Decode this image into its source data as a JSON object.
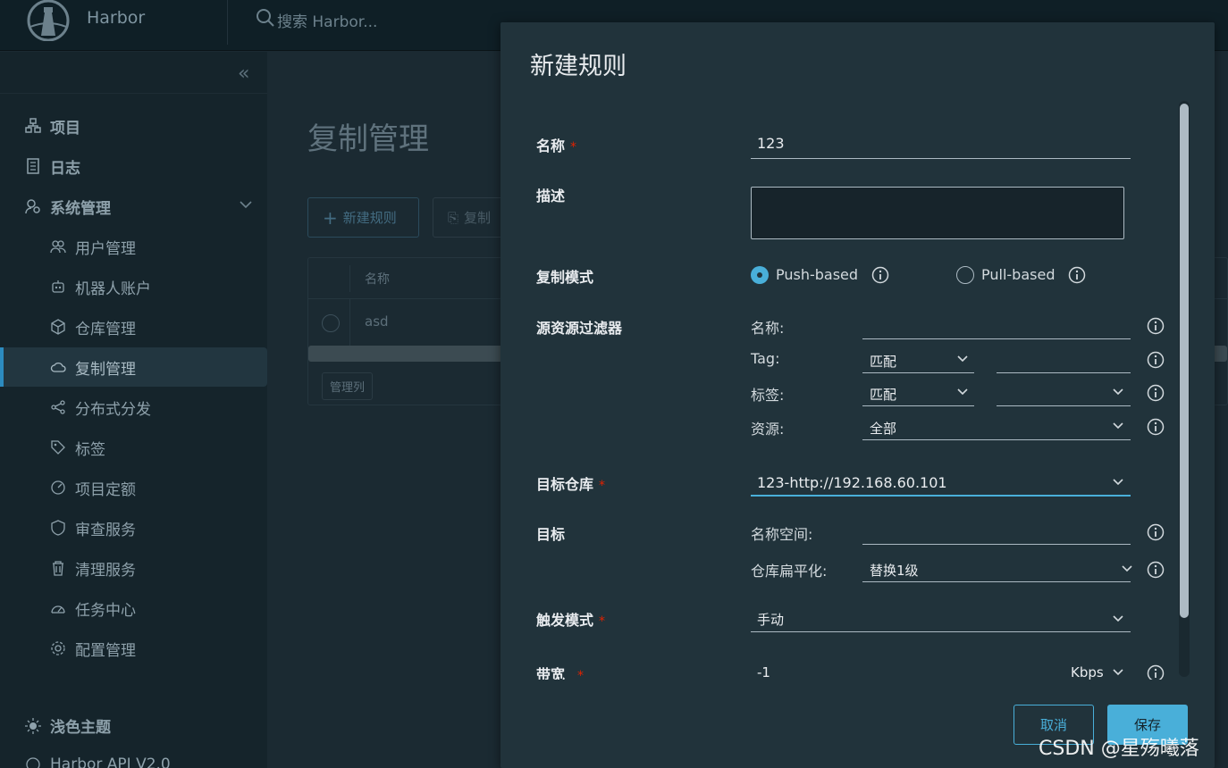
{
  "header": {
    "brand": "Harbor",
    "search_placeholder": "搜索 Harbor..."
  },
  "sidebar": {
    "top_items": [
      {
        "label": "项目",
        "icon": "projects-icon"
      },
      {
        "label": "日志",
        "icon": "logs-icon"
      },
      {
        "label": "系统管理",
        "icon": "admin-icon"
      }
    ],
    "sub_items": [
      {
        "label": "用户管理",
        "icon": "users-icon"
      },
      {
        "label": "机器人账户",
        "icon": "robot-icon"
      },
      {
        "label": "仓库管理",
        "icon": "registry-icon"
      },
      {
        "label": "复制管理",
        "icon": "cloud-icon",
        "active": true
      },
      {
        "label": "分布式分发",
        "icon": "share-icon"
      },
      {
        "label": "标签",
        "icon": "tag-icon"
      },
      {
        "label": "项目定额",
        "icon": "quota-icon"
      },
      {
        "label": "审查服务",
        "icon": "shield-icon"
      },
      {
        "label": "清理服务",
        "icon": "trash-icon"
      },
      {
        "label": "任务中心",
        "icon": "dashboard-icon"
      },
      {
        "label": "配置管理",
        "icon": "gear-icon"
      }
    ],
    "theme_label": "浅色主题",
    "api_label": "Harbor API V2.0"
  },
  "main": {
    "title": "复制管理",
    "new_rule_button": "新建规则",
    "copy_button": "复制",
    "grid": {
      "column_name": "名称",
      "rows": [
        {
          "name": "asd"
        }
      ],
      "columns_button": "管理列"
    }
  },
  "modal": {
    "title": "新建规则",
    "name": {
      "label": "名称",
      "value": "123"
    },
    "description": {
      "label": "描述",
      "value": ""
    },
    "replication_mode": {
      "label": "复制模式",
      "options": [
        "Push-based",
        "Pull-based"
      ],
      "selected": "Push-based"
    },
    "source_filter": {
      "label": "源资源过滤器",
      "name_label": "名称:",
      "tag_label": "Tag:",
      "tag_match": "匹配",
      "label_label": "标签:",
      "label_match": "匹配",
      "resource_label": "资源:",
      "resource_value": "全部"
    },
    "target_registry": {
      "label": "目标仓库",
      "value": "123-http://192.168.60.101"
    },
    "target": {
      "label": "目标",
      "namespace_label": "名称空间:",
      "flatten_label": "仓库扁平化:",
      "flatten_value": "替换1级"
    },
    "trigger_mode": {
      "label": "触发模式",
      "value": "手动"
    },
    "bandwidth": {
      "label": "带宽",
      "value": "-1",
      "unit": "Kbps"
    },
    "cancel_button": "取消",
    "save_button": "保存",
    "required_mark": "*"
  },
  "watermark": "CSDN @星殇曦落",
  "colors": {
    "accent": "#49afd9",
    "required": "#e12200",
    "modal_bg": "#21333b",
    "page_bg": "#1b2a32"
  }
}
